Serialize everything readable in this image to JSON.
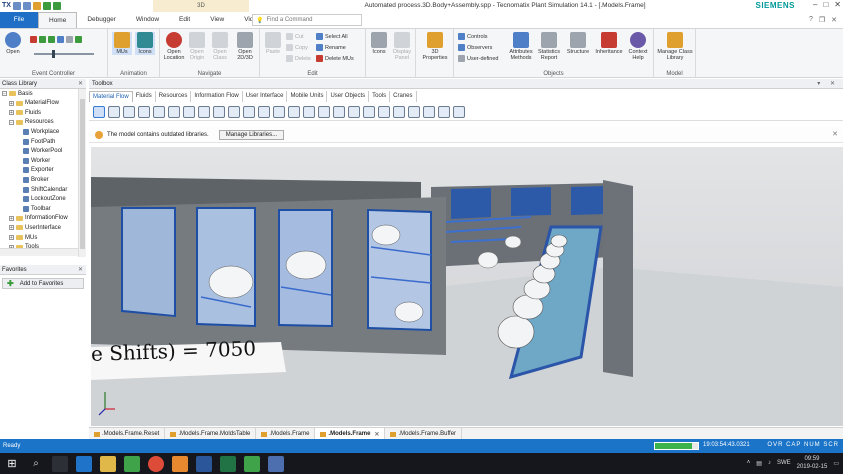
{
  "titlebar": {
    "app_short": "TX",
    "context_tab": "3D",
    "title": "Automated process.3D.Body+Assembly.spp - Tecnomatix Plant Simulation 14.1 - [.Models.Frame]",
    "brand": "SIEMENS"
  },
  "ribbon_tabs": [
    "File",
    "Home",
    "Debugger",
    "Window",
    "Edit",
    "View",
    "Video"
  ],
  "command_search_placeholder": "Find a Command",
  "ribbon": {
    "event_controller": {
      "open": "Open",
      "label": "Event Controller"
    },
    "animation": {
      "mus": "MUs",
      "icons": "Icons",
      "label": "Animation"
    },
    "navigate": {
      "open_location": "Open Location",
      "open_origin": "Open Origin",
      "open_class": "Open Class",
      "open_2d3d": "Open 2D/3D",
      "label": "Navigate"
    },
    "edit": {
      "paste": "Paste",
      "cut": "Cut",
      "copy": "Copy",
      "delete": "Delete",
      "select_all": "Select All",
      "rename": "Rename",
      "delete_mus": "Delete MUs",
      "label": "Edit"
    },
    "icons_group": {
      "icons": "Icons",
      "display_panel": "Display Panel"
    },
    "properties": {
      "label": "3D Properties"
    },
    "objects": {
      "controls": "Controls",
      "observers": "Observers",
      "user_defined": "User-defined",
      "attributes": "Attributes Methods",
      "statistics": "Statistics Report",
      "structure": "Structure",
      "inheritance": "Inheritance",
      "context_help": "Context Help",
      "label": "Objects"
    },
    "model": {
      "manage": "Manage Class Library",
      "label": "Model"
    }
  },
  "class_library": {
    "title": "Class Library",
    "items": [
      {
        "label": "Basis",
        "level": 0
      },
      {
        "label": "MaterialFlow",
        "level": 1
      },
      {
        "label": "Fluids",
        "level": 1
      },
      {
        "label": "Resources",
        "level": 1
      },
      {
        "label": "Workplace",
        "level": 2
      },
      {
        "label": "FootPath",
        "level": 2
      },
      {
        "label": "WorkerPool",
        "level": 2
      },
      {
        "label": "Worker",
        "level": 2
      },
      {
        "label": "Exporter",
        "level": 2
      },
      {
        "label": "Broker",
        "level": 2
      },
      {
        "label": "ShiftCalendar",
        "level": 2
      },
      {
        "label": "LockoutZone",
        "level": 2
      },
      {
        "label": "Toolbar",
        "level": 2
      },
      {
        "label": "InformationFlow",
        "level": 1
      },
      {
        "label": "UserInterface",
        "level": 1
      },
      {
        "label": "MUs",
        "level": 1
      },
      {
        "label": "Tools",
        "level": 1
      }
    ]
  },
  "favorites": {
    "title": "Favorites",
    "add_button": "Add to Favorites"
  },
  "toolbox": {
    "title": "Toolbox",
    "tabs": [
      "Material Flow",
      "Fluids",
      "Resources",
      "Information Flow",
      "User Interface",
      "Mobile Units",
      "User Objects",
      "Tools",
      "Cranes"
    ],
    "active_tab": "Material Flow"
  },
  "infobar": {
    "message": "The model contains outdated libraries.",
    "button": "Manage Libraries..."
  },
  "viewport": {
    "formula_text": "e Shifts) = 7050",
    "axes": [
      "x",
      "y",
      "z"
    ]
  },
  "doc_tabs": [
    ".Models.Frame.Reset",
    ".Models.Frame.MoldsTable",
    ".Models.Frame",
    ".Models.Frame",
    ".Models.Frame.Buffer"
  ],
  "active_doc_tab": 3,
  "status": {
    "text": "Ready",
    "sim_time": "19:03:54:43.0321",
    "progress": 0.85,
    "indicators": "OVR CAP NUM SCR"
  },
  "taskbar": {
    "lang": "SWE",
    "time": "09:59",
    "date": "2019-02-15"
  },
  "colors": {
    "accent": "#1b74c8",
    "file_tab": "#1e6fc5",
    "brand": "#009999",
    "progress": "#3cb34a"
  }
}
